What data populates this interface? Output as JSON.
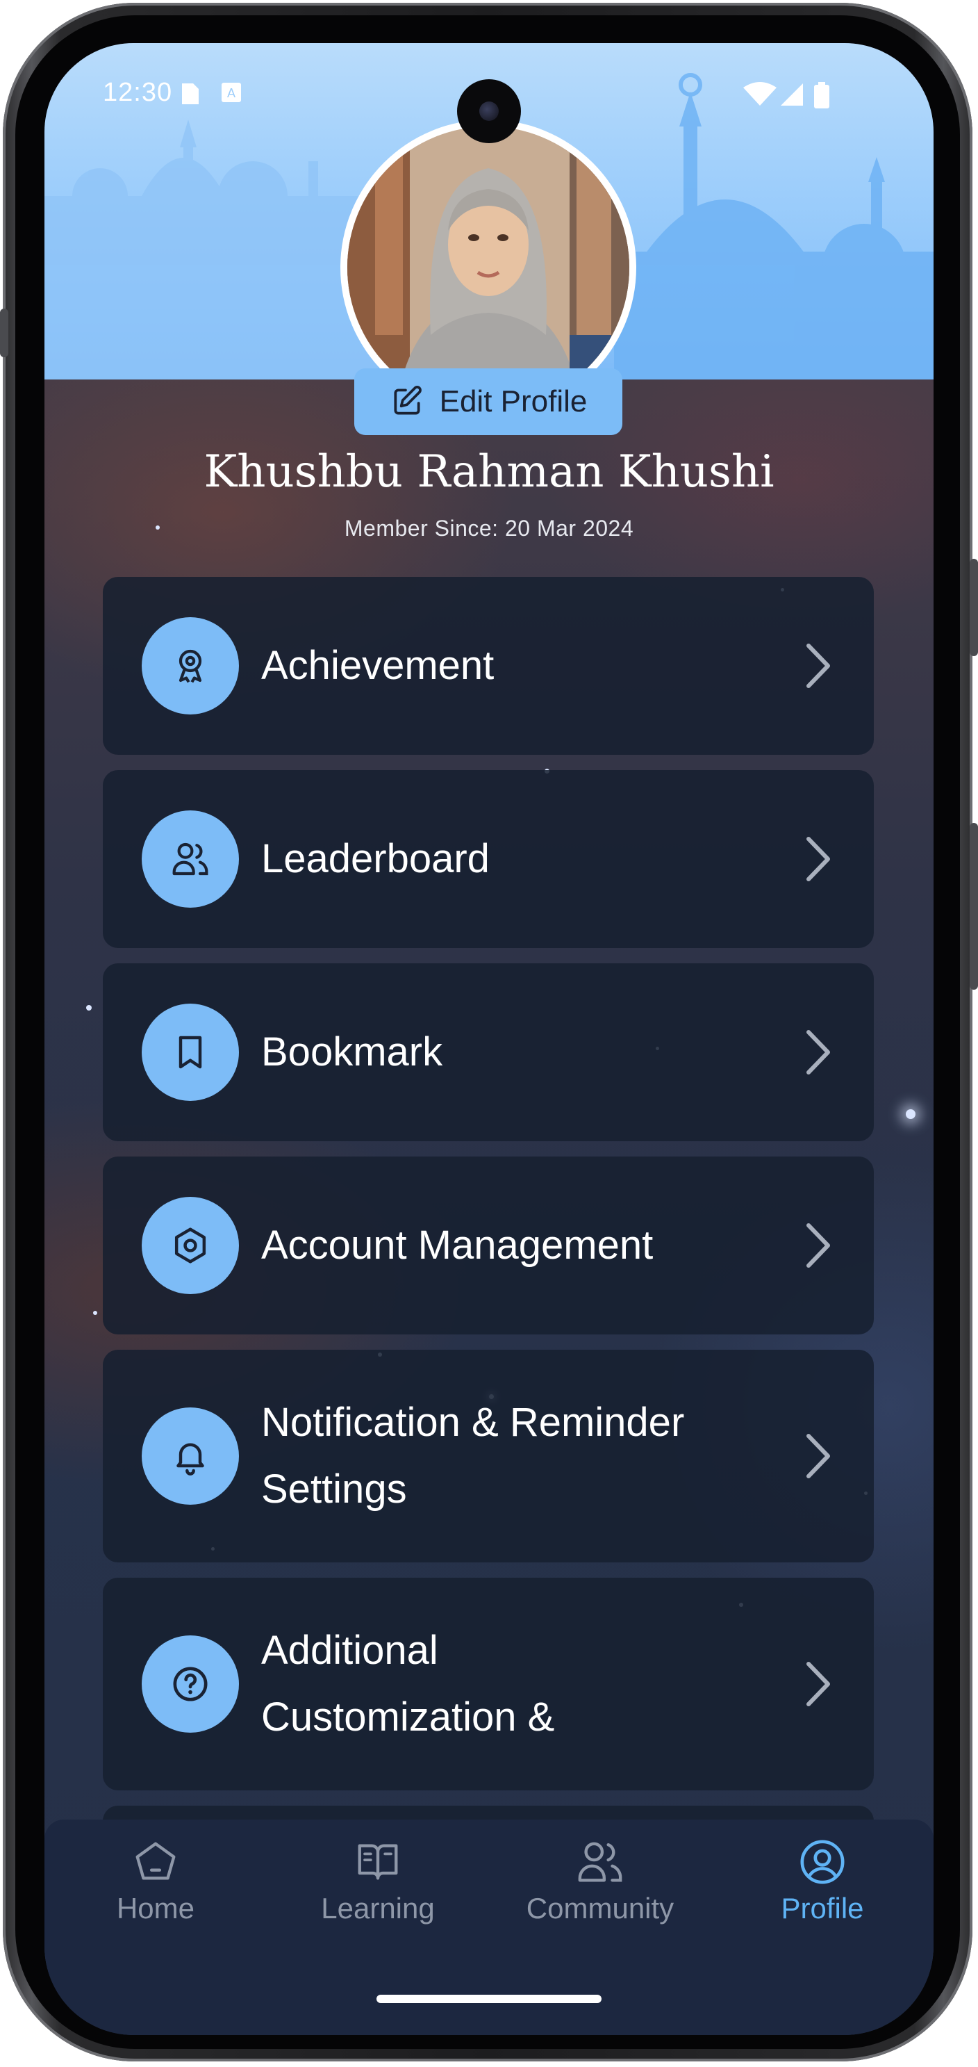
{
  "status_bar": {
    "time": "12:30",
    "icons": [
      "sim-card-icon",
      "keyboard-a-icon",
      "wifi-icon",
      "signal-icon",
      "battery-icon"
    ]
  },
  "profile": {
    "edit_button_label": "Edit Profile",
    "name": "Khushbu Rahman Khushi",
    "member_since": "Member Since: 20 Mar 2024"
  },
  "menu": {
    "items": [
      {
        "label": "Achievement",
        "icon": "award-icon"
      },
      {
        "label": "Leaderboard",
        "icon": "users-icon"
      },
      {
        "label": "Bookmark",
        "icon": "bookmark-icon"
      },
      {
        "label": "Account Management",
        "icon": "settings-hexagon-icon"
      },
      {
        "label_line1": "Notification & Reminder",
        "label_line2": "Settings",
        "icon": "bell-icon"
      },
      {
        "label_line1": "Additional",
        "label_line2": "Customization &",
        "icon": "help-circle-icon"
      }
    ]
  },
  "bottom_nav": {
    "items": [
      {
        "label": "Home",
        "icon": "home-icon"
      },
      {
        "label": "Learning",
        "icon": "book-icon"
      },
      {
        "label": "Community",
        "icon": "users-icon"
      },
      {
        "label": "Profile",
        "icon": "user-circle-icon",
        "active": true
      }
    ]
  },
  "colors": {
    "accent": "#7dbcf7",
    "active_nav": "#5fb3f5",
    "card_bg": "#161f30",
    "nav_bg": "#1c2740"
  }
}
